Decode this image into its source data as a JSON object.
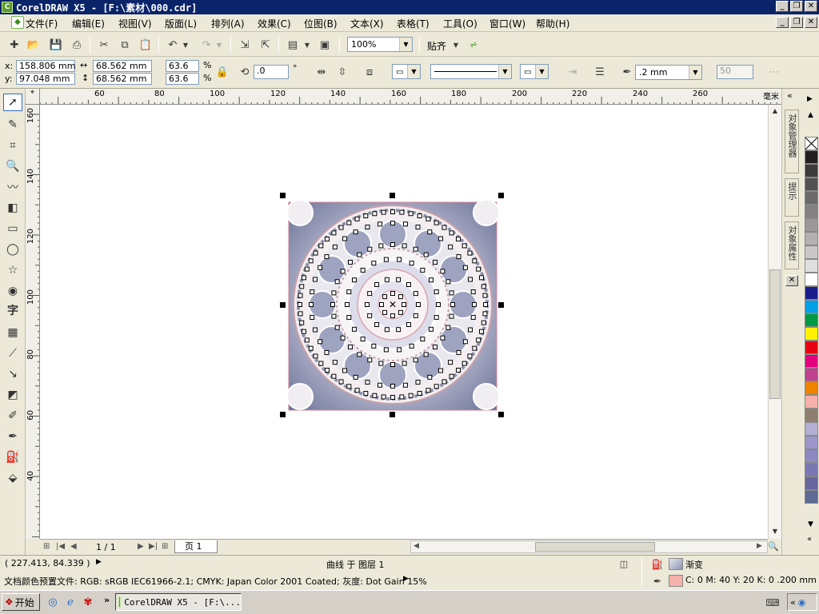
{
  "window": {
    "title": "CorelDRAW X5 - [F:\\素材\\000.cdr]",
    "app_icon": "corel-balloon-icon"
  },
  "menu": [
    "文件(F)",
    "编辑(E)",
    "视图(V)",
    "版面(L)",
    "排列(A)",
    "效果(C)",
    "位图(B)",
    "文本(X)",
    "表格(T)",
    "工具(O)",
    "窗口(W)",
    "帮助(H)"
  ],
  "toolbar": {
    "zoom_value": "100%",
    "snap_label": "贴齐"
  },
  "property_bar": {
    "x_label": "x:",
    "x_value": "158.806 mm",
    "y_label": "y:",
    "y_value": "97.048 mm",
    "width_value": "68.562 mm",
    "height_value": "68.562 mm",
    "scale_w": "63.6",
    "scale_h": "63.6",
    "percent": "%",
    "rotation_value": ".0",
    "degree": "°",
    "outline_width": ".2 mm",
    "mitre_value": "50"
  },
  "rulers": {
    "unit": "毫米",
    "h_ticks": [
      "60",
      "80",
      "100",
      "120",
      "140",
      "160",
      "180",
      "200",
      "220",
      "240",
      "260"
    ],
    "v_ticks": [
      "160",
      "140",
      "120",
      "100",
      "80",
      "60",
      "40"
    ]
  },
  "dockers": {
    "object_manager": "对象管理器",
    "hints": "提示",
    "object_properties": "对象属性"
  },
  "palette": [
    "#ffffff",
    "#231f20",
    "#3c3a3b",
    "#535152",
    "#6b696a",
    "#838182",
    "#9a9899",
    "#b2b0b1",
    "#c9c7c8",
    "#e0dfdf",
    "#ffffff",
    "#1b1c8c",
    "#00a0e9",
    "#009944",
    "#fff100",
    "#e60012",
    "#e4007f",
    "#c0418e",
    "#f08300",
    "#f5b1aa",
    "#8f7e6f",
    "#b3aed3",
    "#9b95c9",
    "#8c8ac0",
    "#7a78b2",
    "#68679d",
    "#5c6a94"
  ],
  "page_nav": {
    "counter": "1 / 1",
    "tab_label": "页 1"
  },
  "status": {
    "cursor_coords": "( 227.413, 84.339 )",
    "object_info": "曲线 于 图层 1",
    "color_profile": "文档颜色预置文件: RGB: sRGB IEC61966-2.1; CMYK: Japan Color 2001 Coated; 灰度: Dot Gain 15%",
    "fill_label": "渐变",
    "outline_info": "C: 0 M: 40 Y: 20 K: 0  .200 mm"
  },
  "taskbar": {
    "start_label": "开始",
    "task_label": "CorelDRAW X5 - [F:\\..."
  }
}
